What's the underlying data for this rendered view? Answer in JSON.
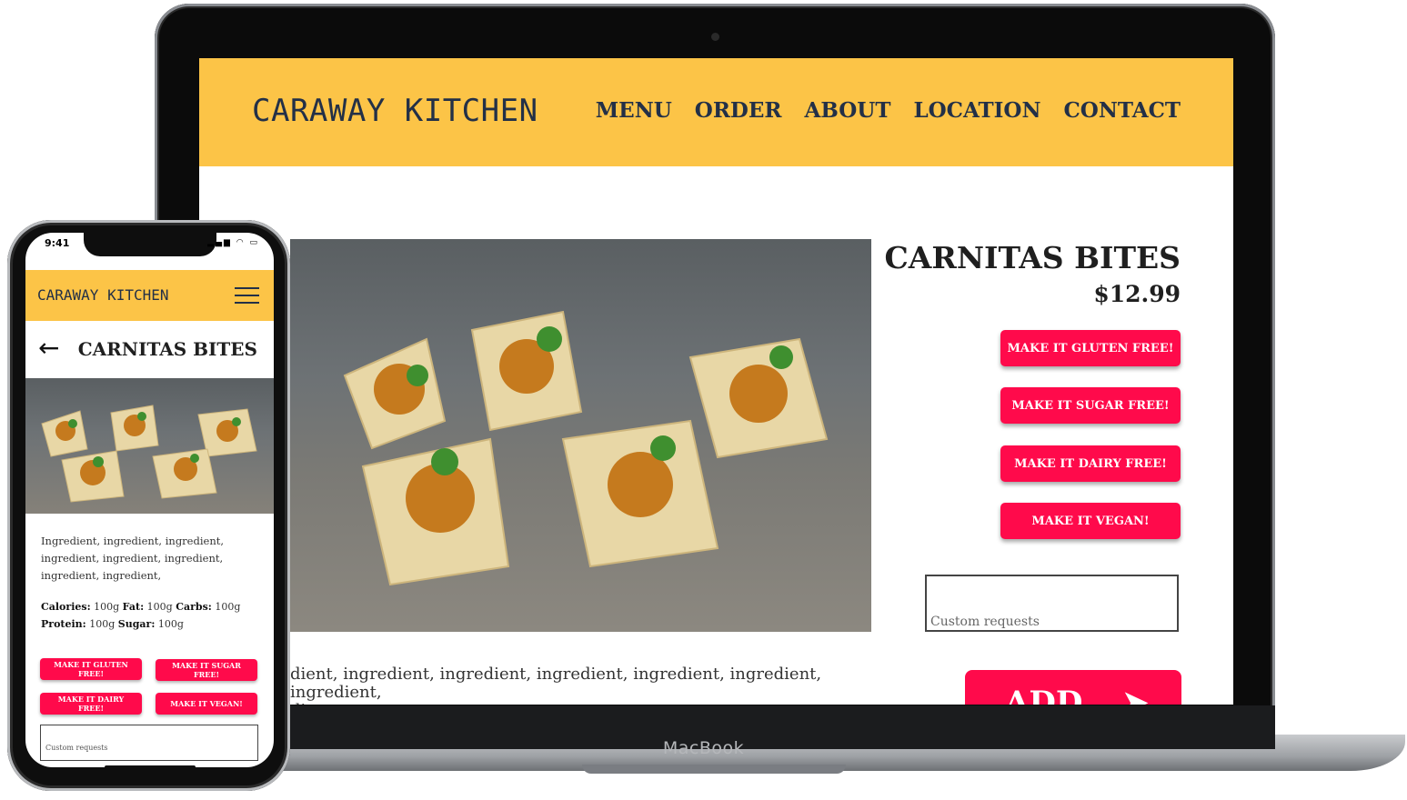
{
  "desktop": {
    "brand": "CARAWAY KITCHEN",
    "nav": [
      "MENU",
      "ORDER",
      "ABOUT",
      "LOCATION",
      "CONTACT"
    ],
    "product_title": "CARNITAS BITES",
    "price": "$12.99",
    "options": [
      "MAKE IT GLUTEN FREE!",
      "MAKE IT SUGAR FREE!",
      "MAKE IT DAIRY FREE!",
      "MAKE IT VEGAN!"
    ],
    "custom_placeholder": "Custom requests",
    "ingredients": "dient, ingredient, ingredient, ingredient, ingredient, ingredient, ingredient,\ndient",
    "add_label": "ADD",
    "device_label": "MacBook"
  },
  "mobile": {
    "time": "9:41",
    "status_icons": "▂▄▆ ◠ ▭",
    "brand": "CARAWAY KITCHEN",
    "product_title": "CARNITAS BITES",
    "ingredients": "Ingredient, ingredient, ingredient, ingredient, ingredient, ingredient, ingredient, ingredient,",
    "nutrition": {
      "calories_label": "Calories:",
      "calories": "100g",
      "fat_label": "Fat:",
      "fat": "100g",
      "carbs_label": "Carbs:",
      "carbs": "100g",
      "protein_label": "Protein:",
      "protein": "100g",
      "sugar_label": "Sugar:",
      "sugar": "100g"
    },
    "options": [
      "MAKE IT GLUTEN FREE!",
      "MAKE IT SUGAR FREE!",
      "MAKE IT DAIRY FREE!",
      "MAKE IT VEGAN!"
    ],
    "custom_placeholder": "Custom requests"
  },
  "colors": {
    "header": "#fcc447",
    "accent": "#ff0a4b",
    "navy": "#233047"
  },
  "icons": {
    "back": "arrow-left-icon",
    "menu": "hamburger-menu-icon",
    "add": "send-arrow-icon"
  }
}
